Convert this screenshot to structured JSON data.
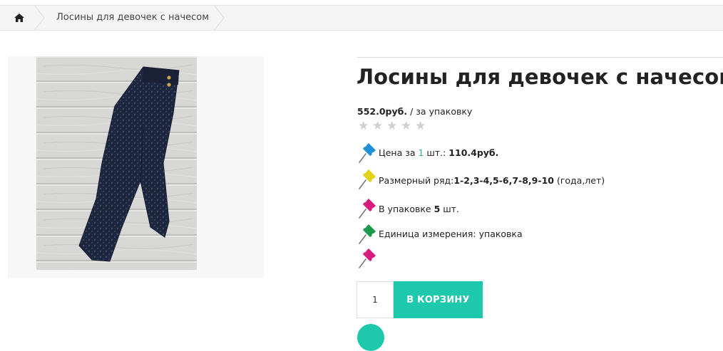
{
  "breadcrumb": {
    "home_icon": "home-icon",
    "current": "Лосины для девочек с начесом"
  },
  "product": {
    "image_alt": "Лосины для девочек с начесом",
    "title": "Лосины для девочек с начесом",
    "price": "552.0руб.",
    "price_unit": " / за упаковку",
    "rating_stars": 5,
    "rating_value": 0,
    "features": [
      {
        "icon": "pushpin-blue-icon",
        "label": "Цена за ",
        "accent": "1",
        "label2": " шт.: ",
        "value": "110.4руб."
      },
      {
        "icon": "pushpin-yellow-icon",
        "label": "Размерный ряд:",
        "value": "1-2,3-4,5-6,7-8,9-10",
        "suffix": " (года,лет)"
      },
      {
        "icon": "pushpin-magenta-icon",
        "label": "В упаковке ",
        "value": "5",
        "suffix": " шт."
      },
      {
        "icon": "pushpin-green-icon",
        "label": "Единица измерения: упаковка"
      },
      {
        "icon": "pushpin-magenta-icon"
      }
    ]
  },
  "cart": {
    "quantity": "1",
    "add_to_cart_label": "В КОРЗИНУ"
  },
  "colors": {
    "accent": "#1dc8ad",
    "breadcrumb_bg": "#f5f5f5",
    "star_empty": "#d0d0d0"
  }
}
